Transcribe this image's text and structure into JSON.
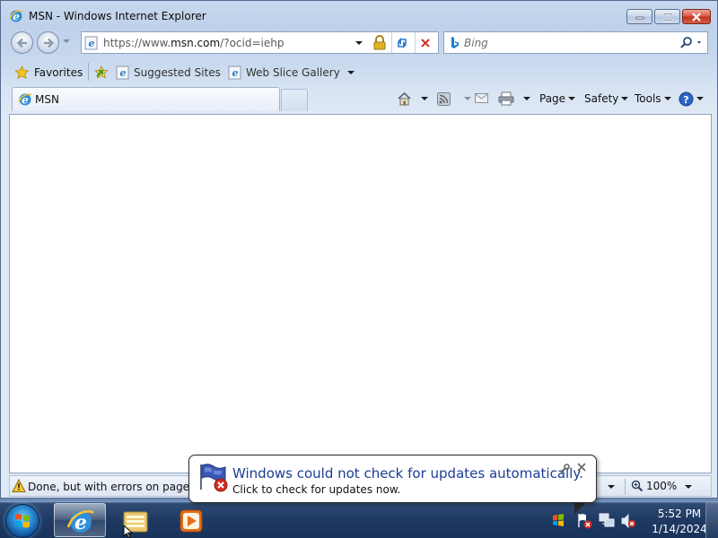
{
  "window": {
    "title": "MSN - Windows Internet Explorer"
  },
  "address_bar": {
    "url_prefix": "https://www.",
    "url_domain": "msn.com",
    "url_rest": "/?ocid=iehp"
  },
  "search": {
    "placeholder": "Bing"
  },
  "favorites_bar": {
    "favorites_label": "Favorites",
    "items": [
      {
        "label": "Suggested Sites"
      },
      {
        "label": "Web Slice Gallery"
      }
    ]
  },
  "tabs": [
    {
      "label": "MSN"
    }
  ],
  "command_bar": {
    "page_label": "Page",
    "safety_label": "Safety",
    "tools_label": "Tools"
  },
  "status_bar": {
    "text": "Done, but with errors on page.",
    "zoom": "100%"
  },
  "notification": {
    "title": "Windows could not check for updates automatically.",
    "body": "Click to check for updates now."
  },
  "taskbar": {
    "time": "5:52 PM",
    "date": "1/14/2024"
  },
  "colors": {
    "accent": "#1a3d92",
    "taskbar": "#1f3a62",
    "close_button": "#c2331b"
  },
  "icons": [
    "ie-icon",
    "back-arrow-icon",
    "forward-arrow-icon",
    "lock-icon",
    "refresh-icon",
    "stop-icon",
    "bing-icon",
    "search-icon",
    "star-icon",
    "home-icon",
    "feeds-icon",
    "mail-icon",
    "print-icon",
    "help-icon",
    "warning-icon",
    "zoom-icon",
    "windows-flag-icon",
    "folder-icon",
    "media-player-icon"
  ]
}
